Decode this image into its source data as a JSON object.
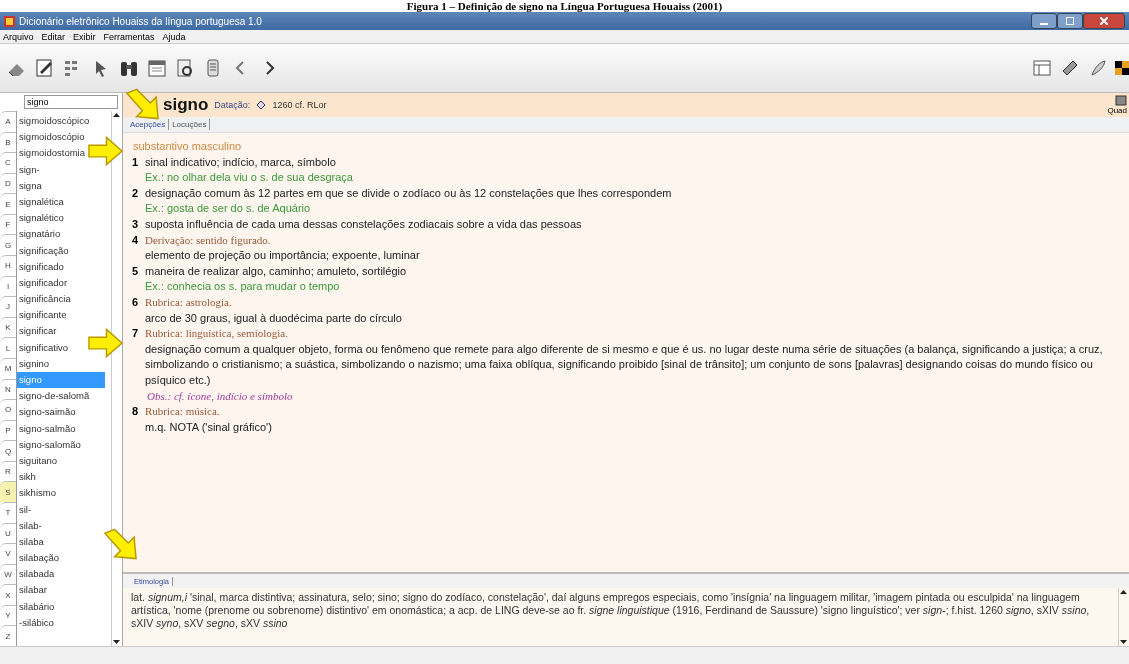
{
  "caption": "Figura 1 – Definição de signo na Língua Portuguesa Houaiss (2001)",
  "window": {
    "title": "Dicionário eletrônico Houaiss da língua portuguesa 1.0"
  },
  "menu": [
    "Arquivo",
    "Editar",
    "Exibir",
    "Ferramentas",
    "Ajuda"
  ],
  "sidebar": {
    "search_value": "signo",
    "letters": [
      {
        "label": "A",
        "selected": false
      },
      {
        "label": "B",
        "selected": false
      },
      {
        "label": "C",
        "selected": false
      },
      {
        "label": "D",
        "selected": false
      },
      {
        "label": "E",
        "selected": false
      },
      {
        "label": "F",
        "selected": false
      },
      {
        "label": "G",
        "selected": false
      },
      {
        "label": "H",
        "selected": false
      },
      {
        "label": "I",
        "selected": false
      },
      {
        "label": "J",
        "selected": false
      },
      {
        "label": "K",
        "selected": false
      },
      {
        "label": "L",
        "selected": false
      },
      {
        "label": "M",
        "selected": false
      },
      {
        "label": "N",
        "selected": false
      },
      {
        "label": "O",
        "selected": false
      },
      {
        "label": "P",
        "selected": false
      },
      {
        "label": "Q",
        "selected": false
      },
      {
        "label": "R",
        "selected": false
      },
      {
        "label": "S",
        "selected": true
      },
      {
        "label": "T",
        "selected": false
      },
      {
        "label": "U",
        "selected": false
      },
      {
        "label": "V",
        "selected": false
      },
      {
        "label": "W",
        "selected": false
      },
      {
        "label": "X",
        "selected": false
      },
      {
        "label": "Y",
        "selected": false
      },
      {
        "label": "Z",
        "selected": false
      }
    ],
    "items": [
      {
        "label": "sigmoidoscópico",
        "selected": false
      },
      {
        "label": "sigmoidoscópio",
        "selected": false
      },
      {
        "label": "sigmoidostomia",
        "selected": false
      },
      {
        "label": "sign-",
        "selected": false
      },
      {
        "label": "signa",
        "selected": false
      },
      {
        "label": "signalética",
        "selected": false
      },
      {
        "label": "signalético",
        "selected": false
      },
      {
        "label": "signatário",
        "selected": false
      },
      {
        "label": "significação",
        "selected": false
      },
      {
        "label": "significado",
        "selected": false
      },
      {
        "label": "significador",
        "selected": false
      },
      {
        "label": "significância",
        "selected": false
      },
      {
        "label": "significante",
        "selected": false
      },
      {
        "label": "significar",
        "selected": false
      },
      {
        "label": "significativo",
        "selected": false
      },
      {
        "label": "signino",
        "selected": false
      },
      {
        "label": "signo",
        "selected": true
      },
      {
        "label": "signo-de-salomã",
        "selected": false
      },
      {
        "label": "signo-saimão",
        "selected": false
      },
      {
        "label": "signo-salmão",
        "selected": false
      },
      {
        "label": "signo-salomão",
        "selected": false
      },
      {
        "label": "siguitano",
        "selected": false
      },
      {
        "label": "sikh",
        "selected": false
      },
      {
        "label": "sikhismo",
        "selected": false
      },
      {
        "label": "sil-",
        "selected": false
      },
      {
        "label": "silab-",
        "selected": false
      },
      {
        "label": "silaba",
        "selected": false
      },
      {
        "label": "silabação",
        "selected": false
      },
      {
        "label": "silabada",
        "selected": false
      },
      {
        "label": "silabar",
        "selected": false
      },
      {
        "label": "silabário",
        "selected": false
      },
      {
        "label": "-silábico",
        "selected": false
      }
    ]
  },
  "entry": {
    "headword": "signo",
    "dating_label": "Datação:",
    "dating_value": "1260 cf. RLor",
    "side_label": "Quad",
    "tabs": [
      {
        "label": "Acepções",
        "selected": true
      },
      {
        "label": "Locuções",
        "selected": false
      }
    ],
    "part_of_speech": "substantivo masculino",
    "senses": [
      {
        "number": "1",
        "lines": [
          {
            "kind": "definition",
            "text": "sinal indicativo; indício, marca, símbolo"
          },
          {
            "kind": "example",
            "text": "Ex.: no olhar dela viu o s. de sua desgraça"
          }
        ]
      },
      {
        "number": "2",
        "lines": [
          {
            "kind": "definition",
            "text": "designação comum às 12 partes em que se divide o zodíaco ou às 12 constelações que lhes correspondem"
          },
          {
            "kind": "example",
            "text": "Ex.: gosta de ser do s. de Aquário"
          }
        ]
      },
      {
        "number": "3",
        "lines": [
          {
            "kind": "definition",
            "text": "suposta influência de cada uma dessas constelações zodiacais sobre a vida das pessoas"
          }
        ]
      },
      {
        "number": "4",
        "lines": [
          {
            "kind": "rubric",
            "text": "Derivação: sentido figurado."
          },
          {
            "kind": "definition",
            "text": "elemento de projeção ou importância; expoente, luminar"
          }
        ]
      },
      {
        "number": "5",
        "lines": [
          {
            "kind": "definition",
            "text": "maneira de realizar algo, caminho; amuleto, sortilégio"
          },
          {
            "kind": "example",
            "text": "Ex.: conhecia os s. para mudar o tempo"
          }
        ]
      },
      {
        "number": "6",
        "lines": [
          {
            "kind": "rubric",
            "text": "Rubrica: astrologia."
          },
          {
            "kind": "definition",
            "text": "arco de 30 graus, igual à duodécima parte do círculo"
          }
        ]
      },
      {
        "number": "7",
        "lines": [
          {
            "kind": "rubric",
            "text": "Rubrica: linguística, semiologia."
          },
          {
            "kind": "definition",
            "text": "designação comum a qualquer objeto, forma ou fenômeno que remete para algo diferente de si mesmo e que é us. no lugar deste numa série de situações (a balança, significando a justiça; a cruz, simbolizando o cristianismo; a suástica, simbolizando o nazismo; uma faixa oblíqua, significando proibido [sinal de trânsito]; um conjunto de sons [palavras] designando coisas do mundo físico ou psíquico etc.)"
          },
          {
            "kind": "note",
            "text": "Obs.: cf. *ícone*, *indício* e *símbolo*"
          }
        ]
      },
      {
        "number": "8",
        "lines": [
          {
            "kind": "rubric",
            "text": "Rubrica: música."
          },
          {
            "kind": "definition",
            "text": "m.q. NOTA ('sinal gráfico')"
          }
        ]
      }
    ]
  },
  "etymology": {
    "tab": {
      "label": "Etimologia",
      "selected": true
    },
    "text": "lat. *signum,i* 'sinal, marca distintiva; assinatura, selo; sino; signo do zodíaco, constelação', daí alguns empregos especiais, como 'insígnia' na linguagem militar, 'imagem pintada ou esculpida' na linguagem artística, 'nome (prenome ou sobrenome) distintivo' em onomástica; a acp. de LING deve-se ao fr. *signe linguistique* (1916, Ferdinand de Saussure) 'signo linguístico'; ver *sign-*; f.hist. 1260 *signo*, sXIV *ssino*, sXIV *syno*, sXV *segno*, sXV *ssino*"
  }
}
